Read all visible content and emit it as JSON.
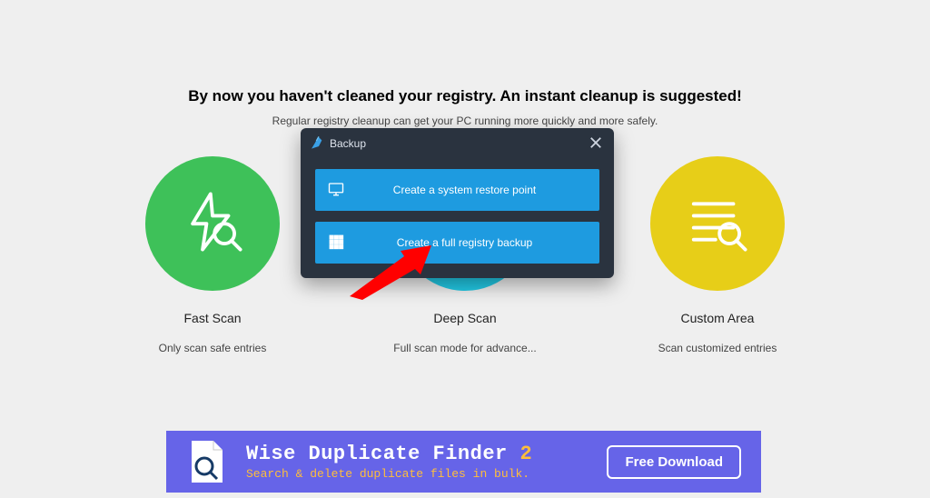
{
  "headline": "By now you haven't cleaned your registry. An instant cleanup is suggested!",
  "subhead": "Regular registry cleanup can get your PC running more quickly and more safely.",
  "scan_options": {
    "fast": {
      "title": "Fast Scan",
      "desc": "Only scan safe entries"
    },
    "deep": {
      "title": "Deep Scan",
      "desc": "Full scan mode for advance..."
    },
    "custom": {
      "title": "Custom Area",
      "desc": "Scan customized entries"
    }
  },
  "modal": {
    "title": "Backup",
    "option_restore": "Create a system restore point",
    "option_full": "Create a full registry backup"
  },
  "banner": {
    "title_main": "Wise Duplicate Finder ",
    "title_version": "2",
    "sub": "Search & delete duplicate files in bulk.",
    "button": "Free Download"
  }
}
